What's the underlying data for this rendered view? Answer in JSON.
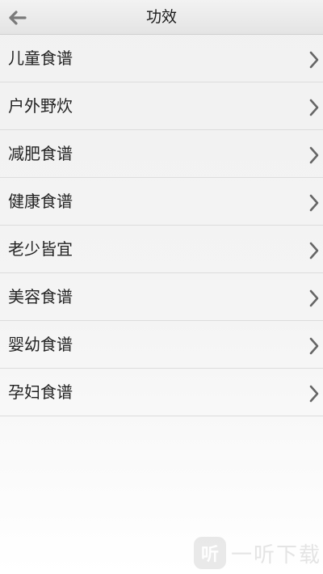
{
  "header": {
    "title": "功效",
    "back_icon": "arrow-left-icon"
  },
  "list": {
    "items": [
      {
        "label": "儿童食谱"
      },
      {
        "label": "户外野炊"
      },
      {
        "label": "减肥食谱"
      },
      {
        "label": "健康食谱"
      },
      {
        "label": "老少皆宜"
      },
      {
        "label": "美容食谱"
      },
      {
        "label": "婴幼食谱"
      },
      {
        "label": "孕妇食谱"
      }
    ],
    "chevron_icon": "chevron-right-icon"
  },
  "watermark": {
    "logo_text": "听",
    "text": "一听下载"
  },
  "colors": {
    "background": "#f4f4f4",
    "divider": "#dcdcdc",
    "chevron": "#666666",
    "back_arrow": "#7a7a7a"
  }
}
